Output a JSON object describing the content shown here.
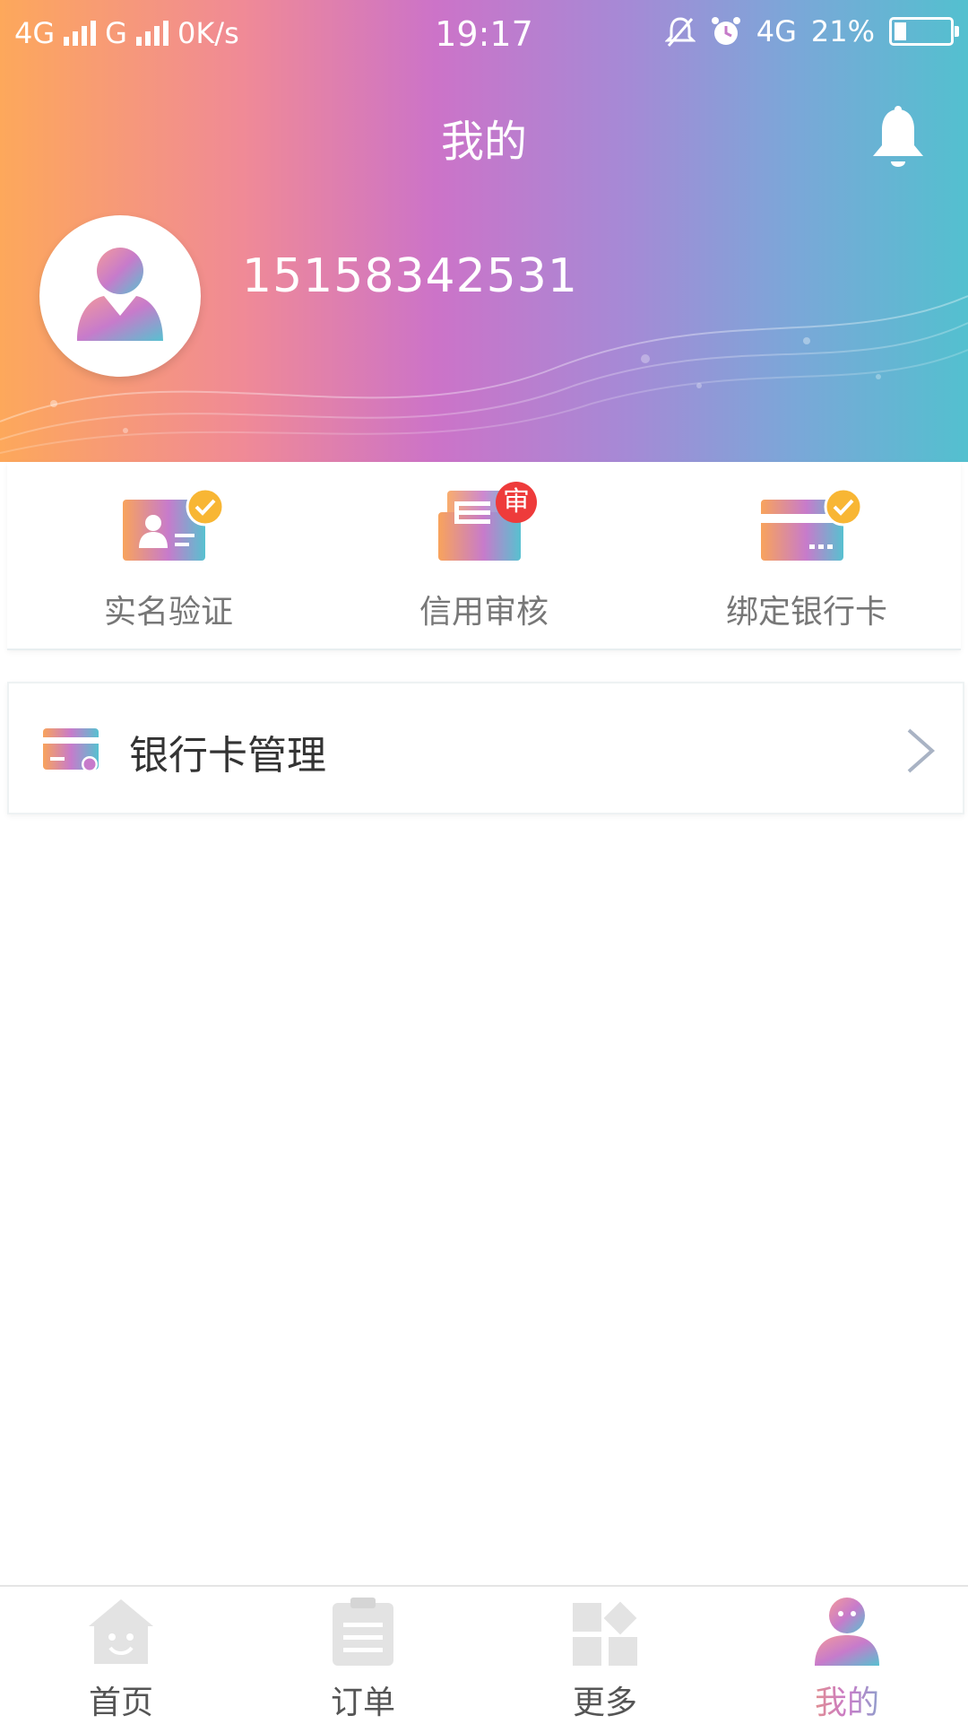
{
  "status_bar": {
    "sim1": "4G",
    "sim2": "G",
    "speed": "0K/s",
    "time": "19:17",
    "net": "4G",
    "battery": "21%",
    "battery_level": 0.21
  },
  "header": {
    "title": "我的",
    "phone": "15158342531"
  },
  "quick_actions": [
    {
      "label": "实名验证"
    },
    {
      "label": "信用审核",
      "badge": "审"
    },
    {
      "label": "绑定银行卡"
    }
  ],
  "menu": {
    "bank_card_manage": "银行卡管理"
  },
  "tabs": [
    {
      "label": "首页"
    },
    {
      "label": "订单"
    },
    {
      "label": "更多"
    },
    {
      "label": "我的"
    }
  ],
  "colors": {
    "gradient_start": "#FDA85B",
    "gradient_mid": "#CC73C8",
    "gradient_end": "#53C0CF",
    "check_badge": "#F8B634",
    "audit_badge": "#EE3B3B"
  }
}
